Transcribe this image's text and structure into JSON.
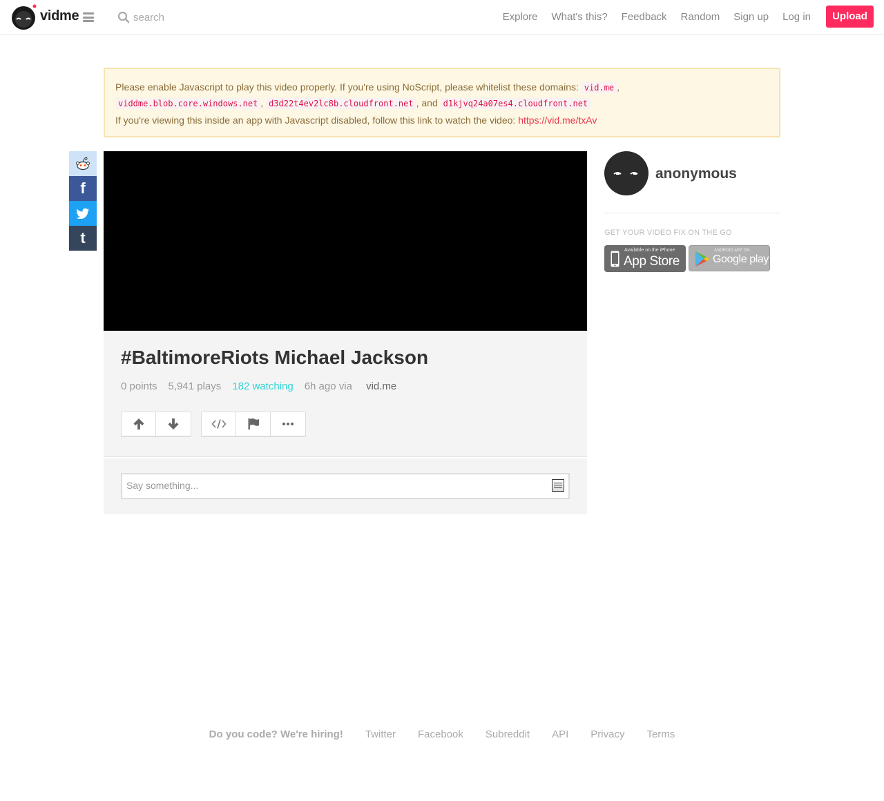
{
  "header": {
    "brand": "vidme",
    "search_placeholder": "search",
    "nav": [
      "Explore",
      "What's this?",
      "Feedback",
      "Random",
      "Sign up",
      "Log in"
    ],
    "upload_label": "Upload",
    "accent": "#ff2b5e"
  },
  "alert": {
    "line1": "Please enable Javascript to play this video properly. If you're using NoScript, please whitelist these domains:",
    "domain1": "vid.me",
    "domain2": "viddme.blob.core.windows.net",
    "domain3": "d3d22t4ev2lc8b.cloudfront.net",
    "and_text": ", and",
    "domain4": "d1kjvq24a07es4.cloudfront.net",
    "line3": "If you're viewing this inside an app with Javascript disabled, follow this link to watch the video:",
    "link": "https://vid.me/txAv"
  },
  "share": [
    "reddit-icon",
    "facebook-icon",
    "twitter-icon",
    "tumblr-icon"
  ],
  "video": {
    "title": "#BaltimoreRiots Michael Jackson",
    "points": "0 points",
    "plays": "5,941 plays",
    "watching": "182 watching",
    "time": "6h ago via",
    "via": "vid.me"
  },
  "actions": [
    "upvote-icon",
    "downvote-icon",
    "embed-icon",
    "flag-icon",
    "more-icon"
  ],
  "comments": {
    "placeholder": "Say something..."
  },
  "sidebar": {
    "username": "anonymous",
    "label": "GET YOUR VIDEO FIX ON THE GO",
    "appstore_small": "Available on the iPhone",
    "appstore_big": "App Store",
    "googleplay_small": "ANDROID APP ON",
    "googleplay_big": "Google play"
  },
  "footer": {
    "hiring": "Do you code? We're hiring!",
    "links": [
      "Twitter",
      "Facebook",
      "Subreddit",
      "API",
      "Privacy",
      "Terms"
    ]
  }
}
